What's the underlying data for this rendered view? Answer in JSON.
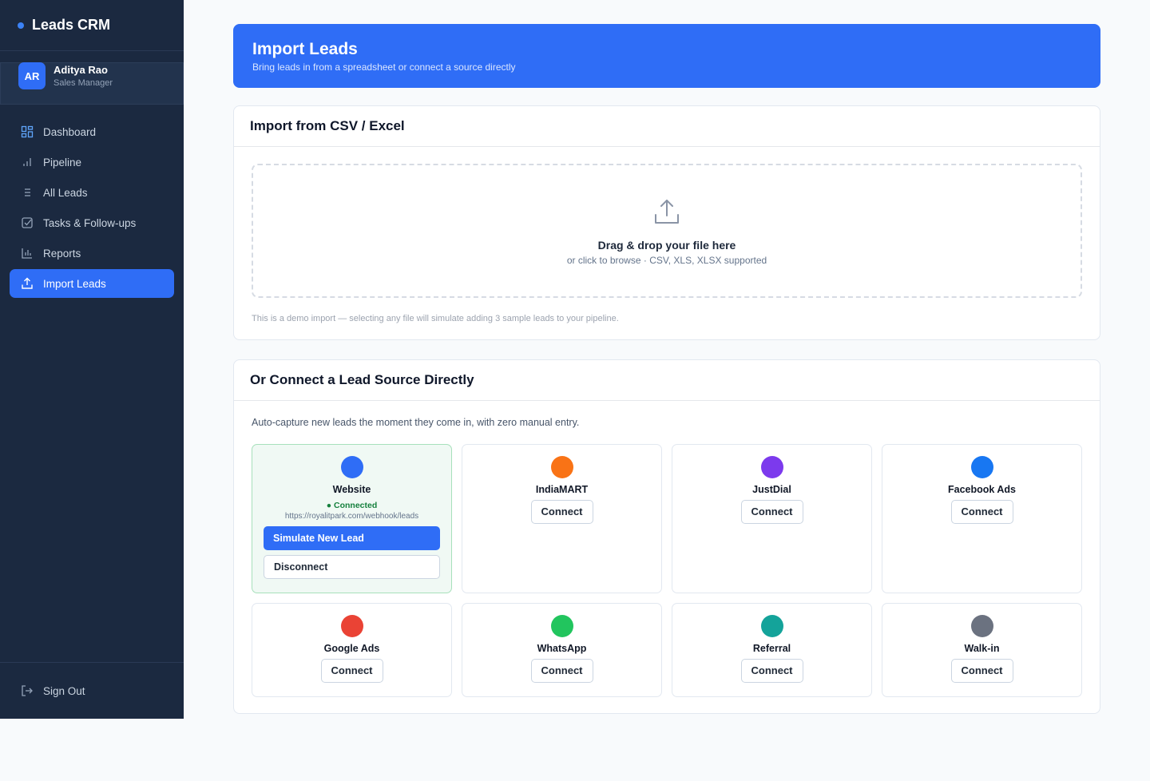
{
  "app": {
    "brand": "Leads CRM"
  },
  "user": {
    "initials": "AR",
    "name": "Aditya Rao",
    "role": "Sales Manager"
  },
  "nav": [
    {
      "label": "Dashboard",
      "icon": "dashboard-icon"
    },
    {
      "label": "Pipeline",
      "icon": "pipeline-icon"
    },
    {
      "label": "All Leads",
      "icon": "list-icon"
    },
    {
      "label": "Tasks & Follow-ups",
      "icon": "task-check-icon"
    },
    {
      "label": "Reports",
      "icon": "bar-chart-icon"
    },
    {
      "label": "Import Leads",
      "icon": "upload-icon",
      "active": true
    }
  ],
  "signout": {
    "label": "Sign Out"
  },
  "banner": {
    "title": "Import Leads",
    "subtitle": "Bring leads in from a spreadsheet or connect a source directly"
  },
  "csv": {
    "title": "Import from CSV / Excel",
    "drop_title": "Drag & drop your file here",
    "drop_sub": "or click to browse · CSV, XLS, XLSX supported",
    "note": "This is a demo import — selecting any file will simulate adding 3 sample leads to your pipeline."
  },
  "sources": {
    "title": "Or Connect a Lead Source Directly",
    "description": "Auto-capture new leads the moment they come in, with zero manual entry.",
    "connect_label": "Connect",
    "items": [
      {
        "name": "Website",
        "color": "#2f6df6",
        "connected": true,
        "status": "● Connected",
        "webhook": "https://royalitpark.com/webhook/leads",
        "simulate_label": "Simulate New Lead",
        "disconnect_label": "Disconnect"
      },
      {
        "name": "IndiaMART",
        "color": "#f97316"
      },
      {
        "name": "JustDial",
        "color": "#7c3aed"
      },
      {
        "name": "Facebook Ads",
        "color": "#1877f2"
      },
      {
        "name": "Google Ads",
        "color": "#ea4335"
      },
      {
        "name": "WhatsApp",
        "color": "#22c55e"
      },
      {
        "name": "Referral",
        "color": "#14a39a"
      },
      {
        "name": "Walk-in",
        "color": "#6b7280"
      }
    ]
  }
}
